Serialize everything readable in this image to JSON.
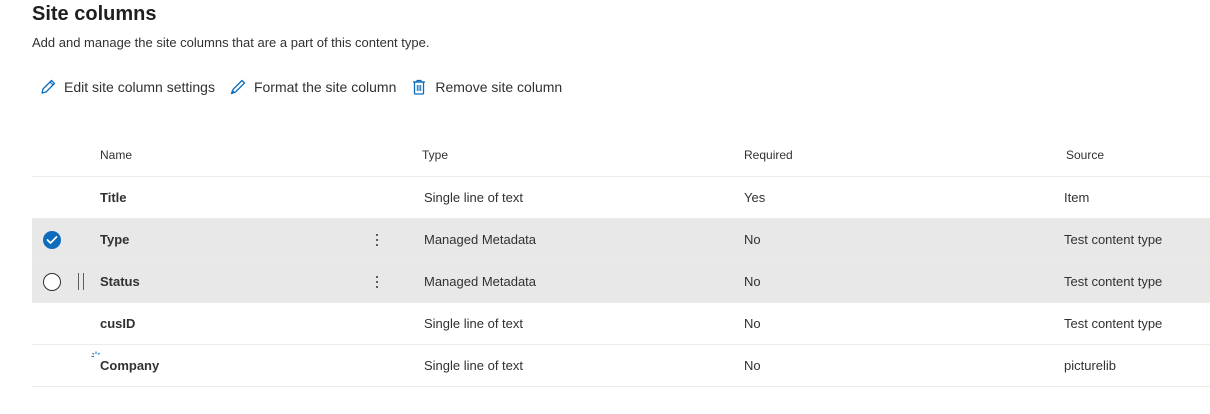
{
  "page": {
    "title": "Site columns",
    "subtitle": "Add and manage the site columns that are a part of this content type."
  },
  "toolbar": {
    "edit_label": "Edit site column settings",
    "format_label": "Format the site column",
    "remove_label": "Remove site column"
  },
  "table": {
    "headers": {
      "name": "Name",
      "type": "Type",
      "required": "Required",
      "source": "Source"
    },
    "rows": [
      {
        "name": "Title",
        "type": "Single line of text",
        "required": "Yes",
        "source": "Item",
        "selected": false
      },
      {
        "name": "Type",
        "type": "Managed Metadata",
        "required": "No",
        "source": "Test content type",
        "selected": true
      },
      {
        "name": "Status",
        "type": "Managed Metadata",
        "required": "No",
        "source": "Test content type",
        "selected": false
      },
      {
        "name": "cusID",
        "type": "Single line of text",
        "required": "No",
        "source": "Test content type",
        "selected": false
      },
      {
        "name": "Company",
        "type": "Single line of text",
        "required": "No",
        "source": "picturelib",
        "selected": false
      }
    ]
  },
  "colors": {
    "accent": "#0f6cbd",
    "selected_row": "#e8e8e8",
    "divider": "#edebe9"
  },
  "icons": [
    "pencil-icon",
    "brush-icon",
    "trash-icon",
    "checkmark-icon",
    "more-vertical-icon",
    "drag-handle-icon",
    "loading-spinner-icon"
  ]
}
